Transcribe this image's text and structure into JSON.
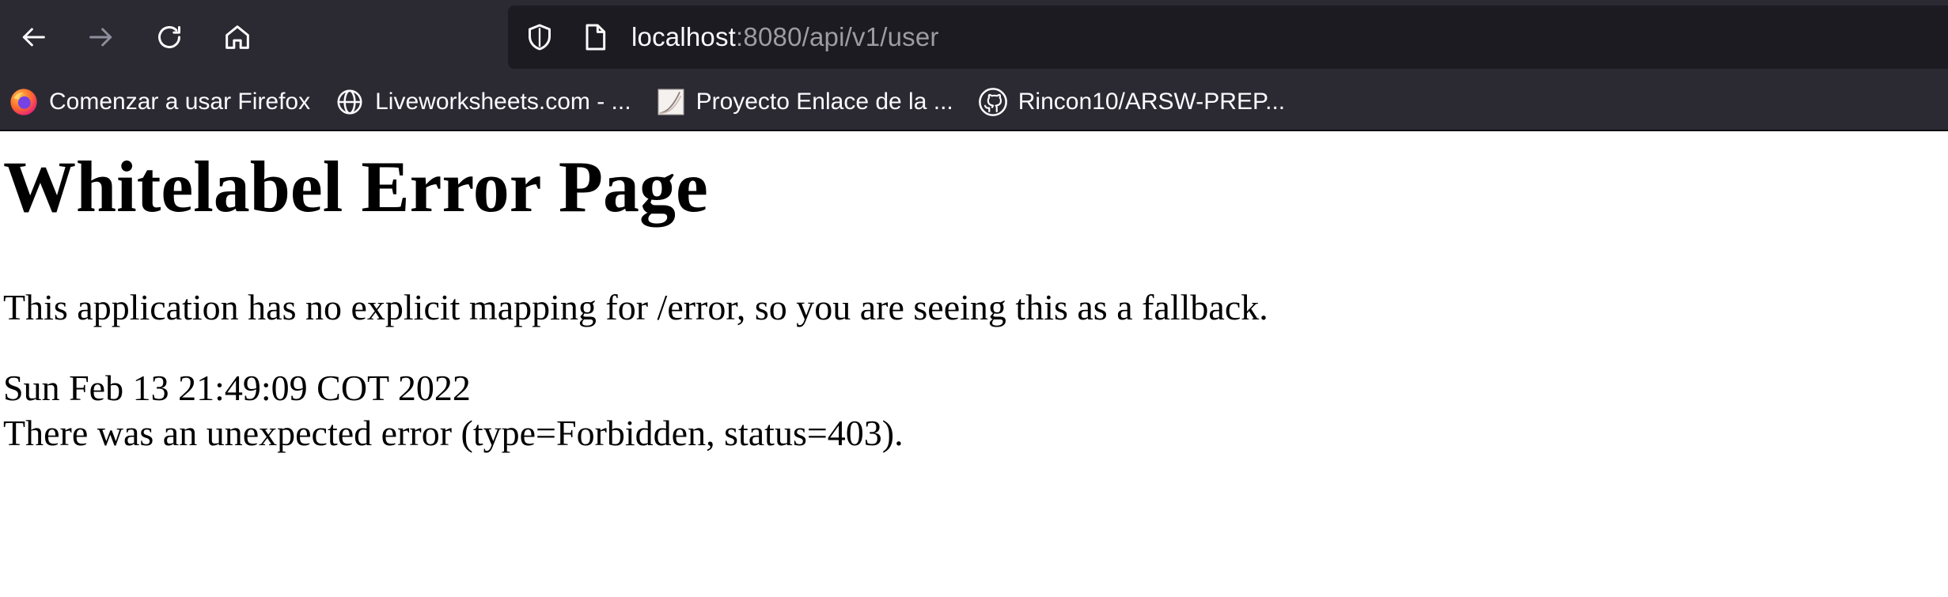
{
  "browser": {
    "url": {
      "host": "localhost",
      "rest": ":8080/api/v1/user"
    },
    "colors": {
      "chrome_bg": "#2b2a33",
      "urlbar_bg": "#1c1b22",
      "text_primary": "#fbfbfe",
      "text_muted": "#9d9ca3"
    },
    "nav_icons": [
      "back-arrow-icon",
      "forward-arrow-icon",
      "reload-icon",
      "home-icon"
    ],
    "bookmarks": [
      {
        "label": "Comenzar a usar Firefox",
        "icon": "firefox-icon"
      },
      {
        "label": "Liveworksheets.com - ...",
        "icon": "globe-icon"
      },
      {
        "label": "Proyecto Enlace de la ...",
        "icon": "document-thumbnail-icon"
      },
      {
        "label": "Rincon10/ARSW-PREP...",
        "icon": "github-icon"
      }
    ]
  },
  "page": {
    "title": "Whitelabel Error Page",
    "message": "This application has no explicit mapping for /error, so you are seeing this as a fallback.",
    "timestamp": "Sun Feb 13 21:49:09 COT 2022",
    "error": "There was an unexpected error (type=Forbidden, status=403)."
  }
}
